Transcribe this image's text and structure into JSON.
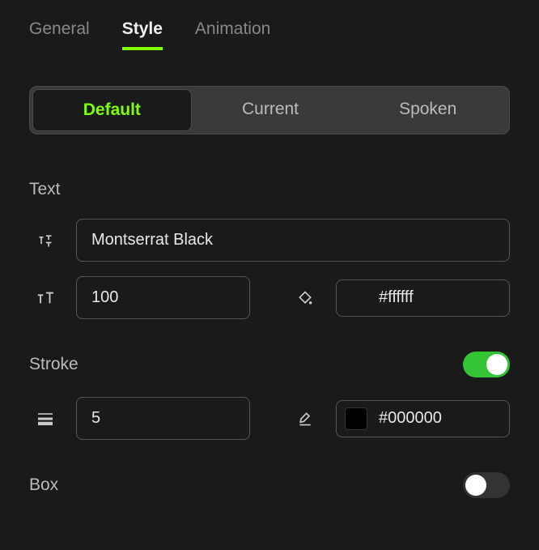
{
  "tabs": {
    "general": "General",
    "style": "Style",
    "animation": "Animation"
  },
  "segments": {
    "default": "Default",
    "current": "Current",
    "spoken": "Spoken"
  },
  "sections": {
    "text": {
      "title": "Text",
      "font": "Montserrat Black",
      "size": "100",
      "color": "#ffffff"
    },
    "stroke": {
      "title": "Stroke",
      "enabled": true,
      "width": "5",
      "color": "#000000"
    },
    "box": {
      "title": "Box",
      "enabled": false
    }
  },
  "colors": {
    "text_swatch": "#ffffff",
    "stroke_swatch": "#000000"
  }
}
